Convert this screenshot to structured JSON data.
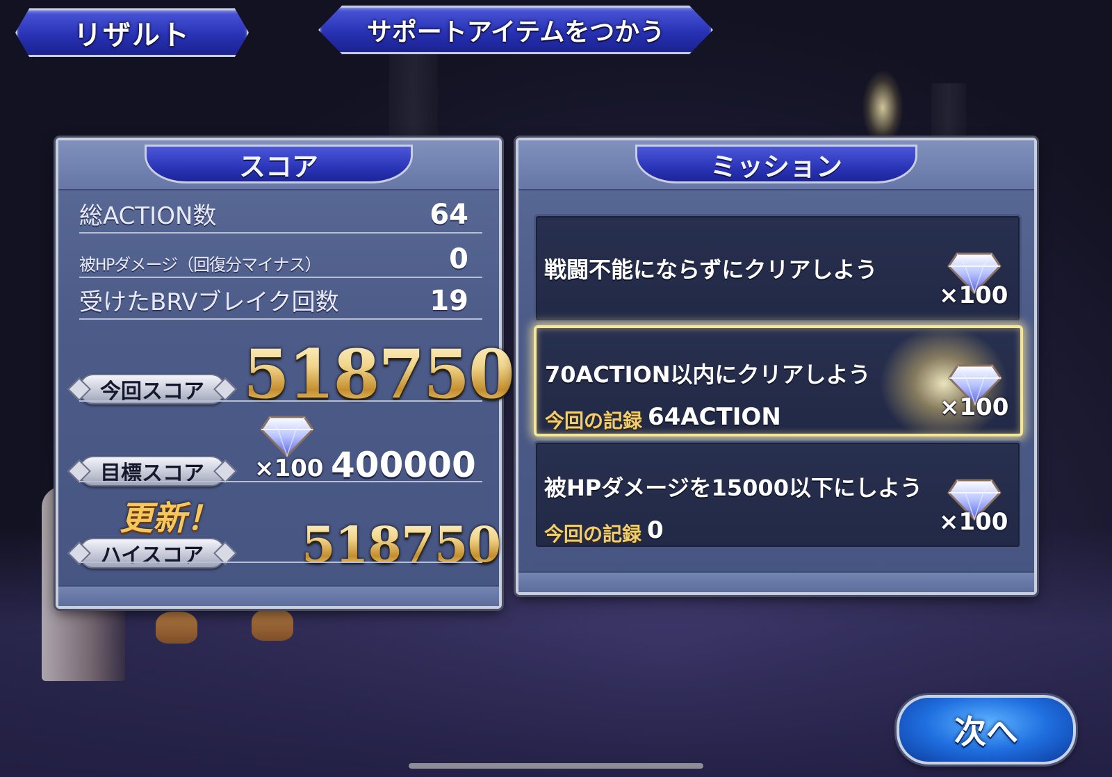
{
  "header": {
    "result_label": "リザルト",
    "support_item_button": "サポートアイテムをつかう"
  },
  "score_panel": {
    "title": "スコア",
    "rows": [
      {
        "label": "総ACTION数",
        "value": "64"
      },
      {
        "label": "被HPダメージ（回復分マイナス）",
        "value": "0"
      },
      {
        "label": "受けたBRVブレイク回数",
        "value": "19"
      }
    ],
    "current_score_label": "今回スコア",
    "current_score": "518750",
    "target_score_label": "目標スコア",
    "target_reward": "×100",
    "target_score": "400000",
    "updated_text": "更新！",
    "high_score_label": "ハイスコア",
    "high_score": "518750"
  },
  "mission_panel": {
    "title": "ミッション",
    "missions": [
      {
        "text": "戦闘不能にならずにクリアしよう",
        "reward": "×100",
        "record_label": "",
        "record_value": "",
        "cleared": false
      },
      {
        "text": "70ACTION以内にクリアしよう",
        "reward": "×100",
        "record_label": "今回の記録",
        "record_value": "64ACTION",
        "cleared": true
      },
      {
        "text": "被HPダメージを15000以下にしよう",
        "reward": "×100",
        "record_label": "今回の記録",
        "record_value": "0",
        "cleared": false
      }
    ]
  },
  "next_button": "次へ",
  "colors": {
    "panel": "#4c5b88",
    "title_badge": "#2a35b8",
    "gold": "#f1d48a",
    "next_button": "#1f6ee0"
  }
}
